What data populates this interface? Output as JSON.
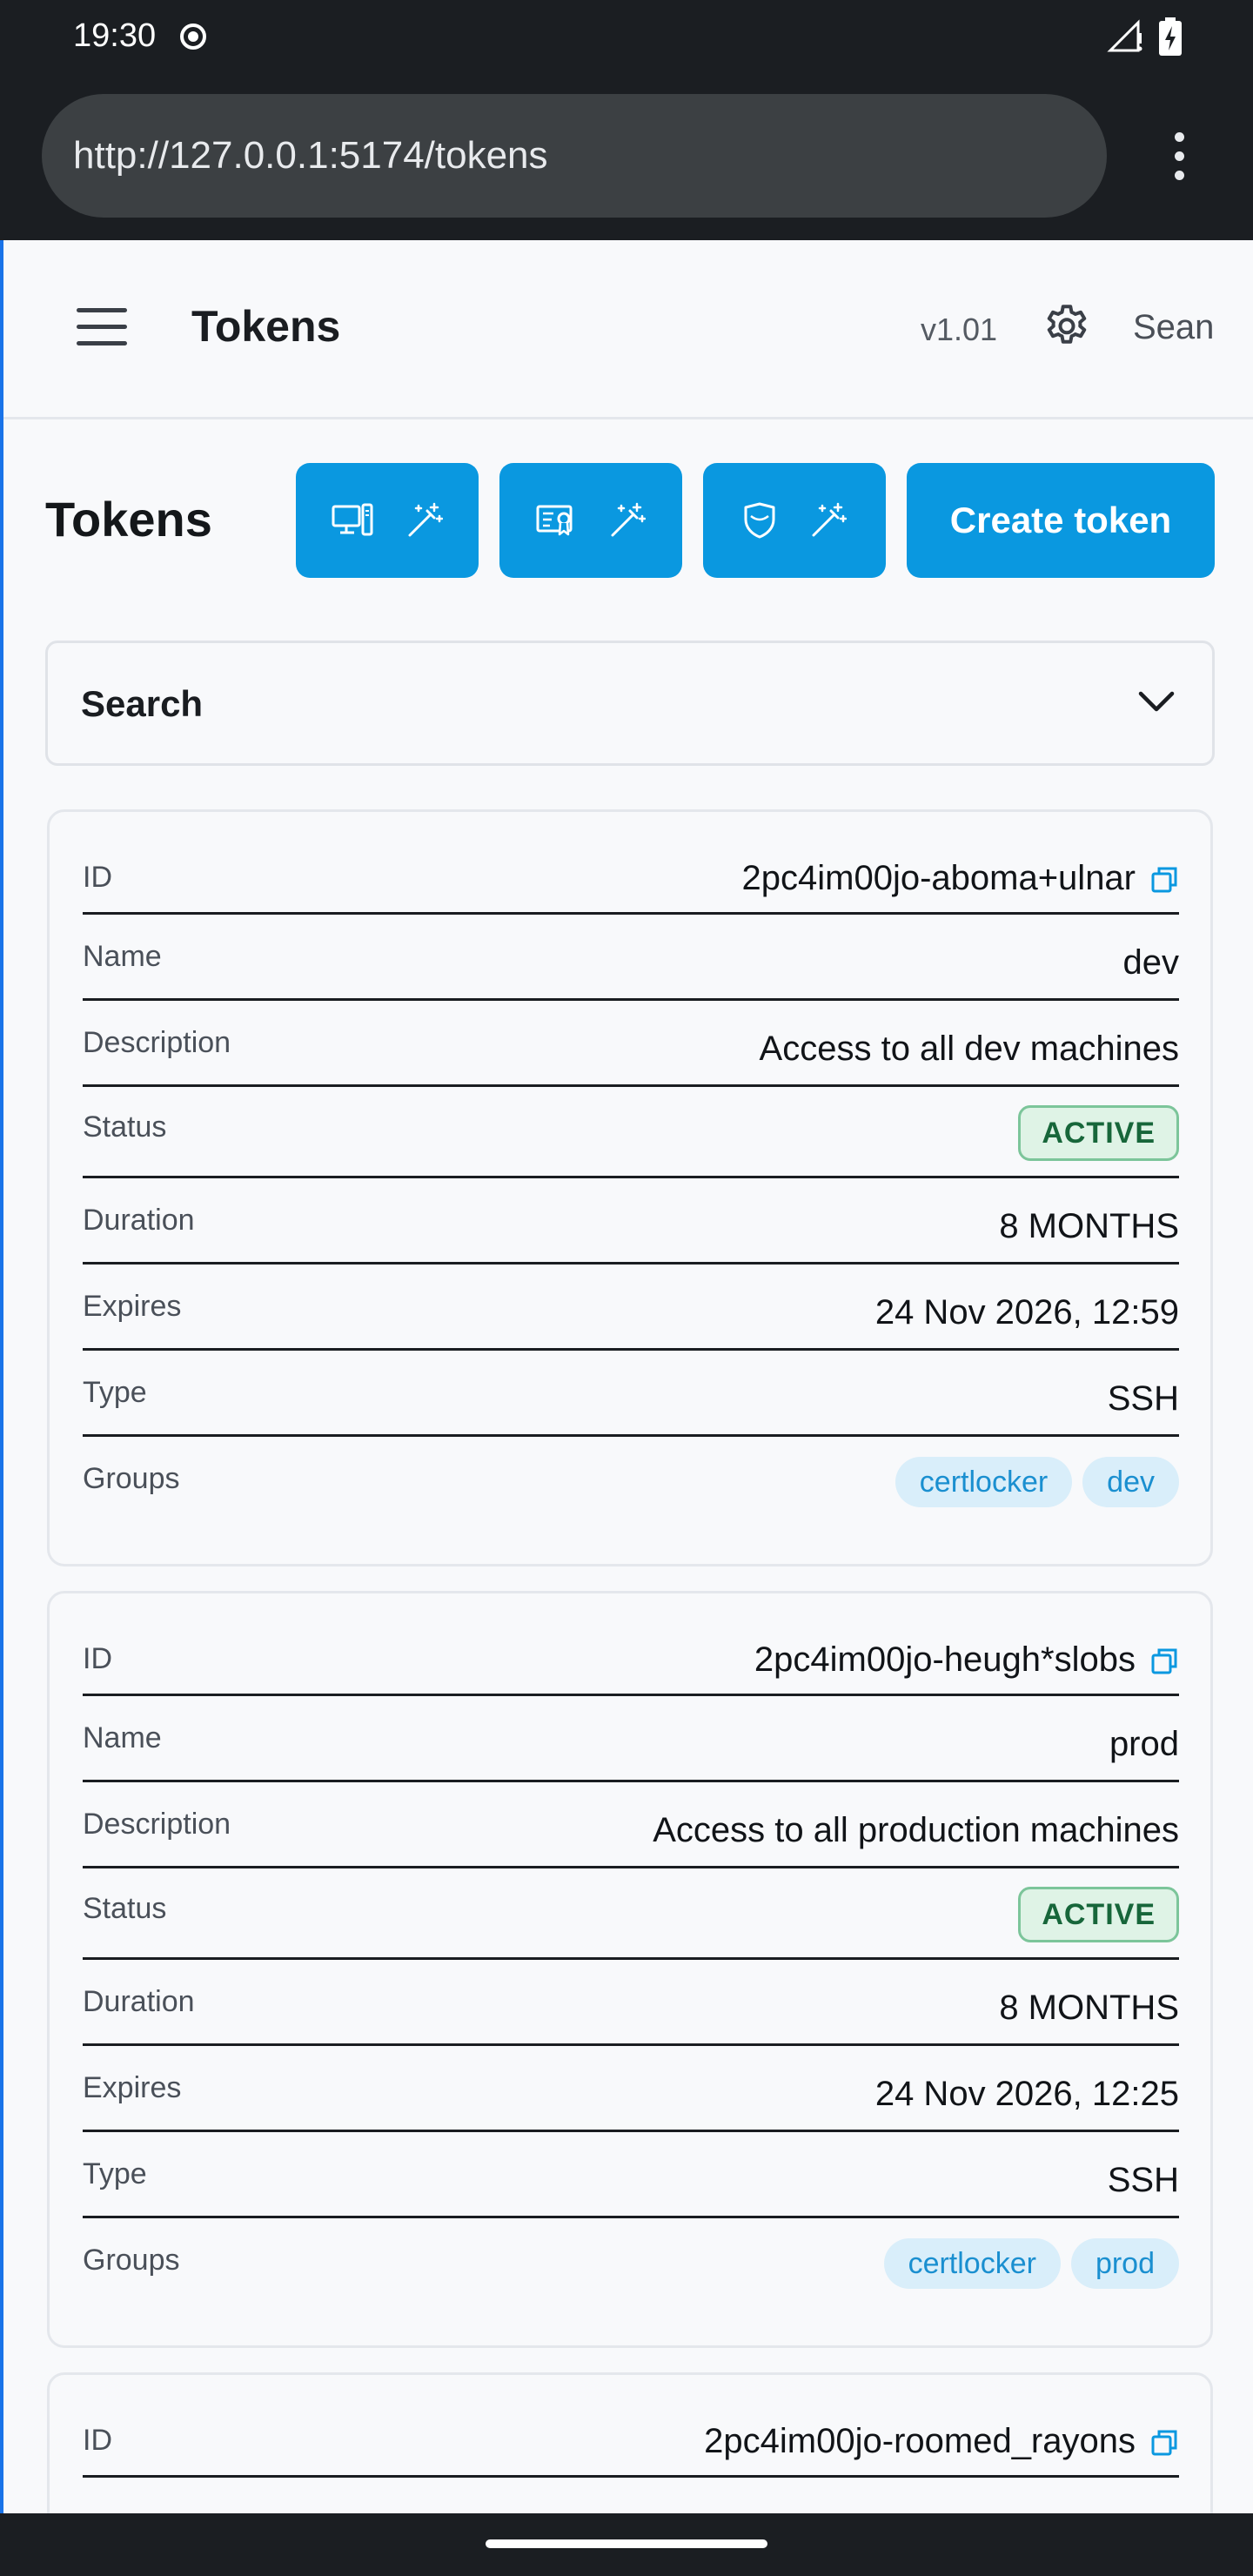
{
  "status_bar": {
    "time": "19:30"
  },
  "browser": {
    "url": "http://127.0.0.1:5174/tokens"
  },
  "header": {
    "title": "Tokens",
    "version": "v1.01",
    "user": "Sean"
  },
  "page": {
    "heading": "Tokens",
    "create_label": "Create token",
    "search_label": "Search"
  },
  "labels": {
    "id": "ID",
    "name": "Name",
    "description": "Description",
    "status": "Status",
    "duration": "Duration",
    "expires": "Expires",
    "type": "Type",
    "groups": "Groups"
  },
  "tokens": [
    {
      "id": "2pc4im00jo-aboma+ulnar",
      "name": "dev",
      "description": "Access to all dev machines",
      "status": "ACTIVE",
      "duration": "8 MONTHS",
      "expires": "24 Nov 2026, 12:59",
      "type": "SSH",
      "groups": [
        "certlocker",
        "dev"
      ]
    },
    {
      "id": "2pc4im00jo-heugh*slobs",
      "name": "prod",
      "description": "Access to all production machines",
      "status": "ACTIVE",
      "duration": "8 MONTHS",
      "expires": "24 Nov 2026, 12:25",
      "type": "SSH",
      "groups": [
        "certlocker",
        "prod"
      ]
    },
    {
      "id": "2pc4im00jo-roomed_rayons"
    }
  ],
  "colors": {
    "primary": "#0a98e0",
    "active_bg": "#dff3e6",
    "active_text": "#17663a",
    "pill_bg": "#d9eefa",
    "pill_text": "#1a8fd0"
  }
}
